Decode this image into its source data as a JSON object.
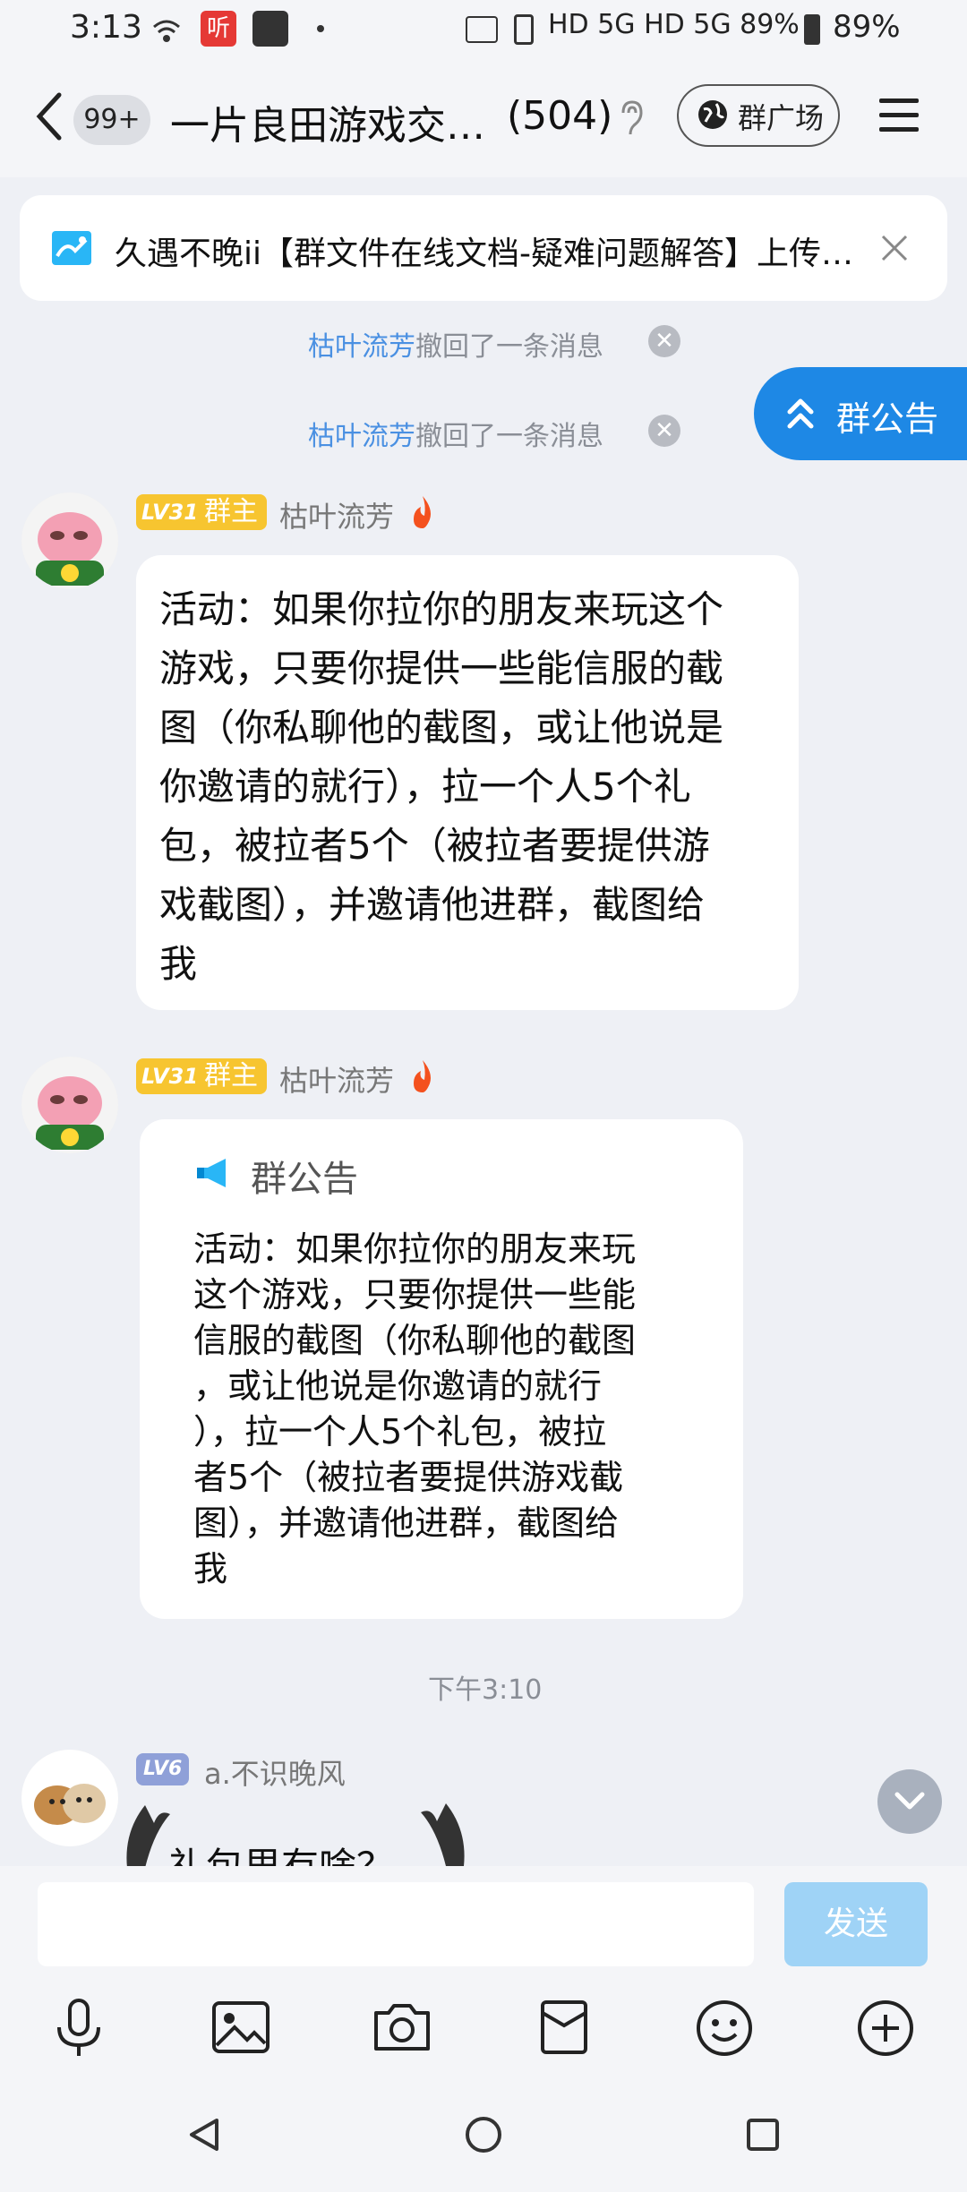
{
  "status_bar": {
    "time": "3:13",
    "right_text": "HD 5G HD 5G 89%",
    "battery": "89%"
  },
  "header": {
    "unread_badge": "99+",
    "group_title": "一片良田游戏交…",
    "member_count": "(504)",
    "plaza_button": "群广场"
  },
  "pinned": {
    "text": "久遇不晚ii【群文件在线文档-疑难问题解答】上传…"
  },
  "system_messages": [
    {
      "name": "枯叶流芳",
      "text": "撤回了一条消息"
    },
    {
      "name": "枯叶流芳",
      "text": "撤回了一条消息"
    }
  ],
  "floating_button": {
    "label": "群公告"
  },
  "messages": [
    {
      "level": "LV31",
      "role": "群主",
      "sender": "枯叶流芳",
      "text_lines": [
        "活动：如果你拉你的朋友来玩这个",
        "游戏，只要你提供一些能信服的截",
        "图（你私聊他的截图，或让他说是",
        "你邀请的就行），拉一个人5个礼",
        "包，被拉者5个（被拉者要提供游",
        "戏截图），并邀请他进群，截图给",
        "我"
      ]
    },
    {
      "level": "LV31",
      "role": "群主",
      "sender": "枯叶流芳",
      "card_title": "群公告",
      "card_lines": [
        "活动：如果你拉你的朋友来玩",
        "这个游戏，只要你提供一些能",
        "信服的截图（你私聊他的截图",
        "，或让他说是你邀请的就行",
        "），拉一个人5个礼包，被拉",
        "者5个（被拉者要提供游戏截",
        "图），并邀请他进群，截图给",
        "我"
      ]
    }
  ],
  "timestamp": "下午3:10",
  "last_message": {
    "level": "LV6",
    "sender": "a.不识晚风",
    "text_partial": "礼包里有啥？"
  },
  "composer": {
    "input_value": "",
    "send_label": "发送"
  },
  "colors": {
    "accent": "#1E88E5",
    "name_link": "#4A90E2",
    "owner_badge": "#F7C530",
    "send_disabled": "#9FD3F6"
  }
}
